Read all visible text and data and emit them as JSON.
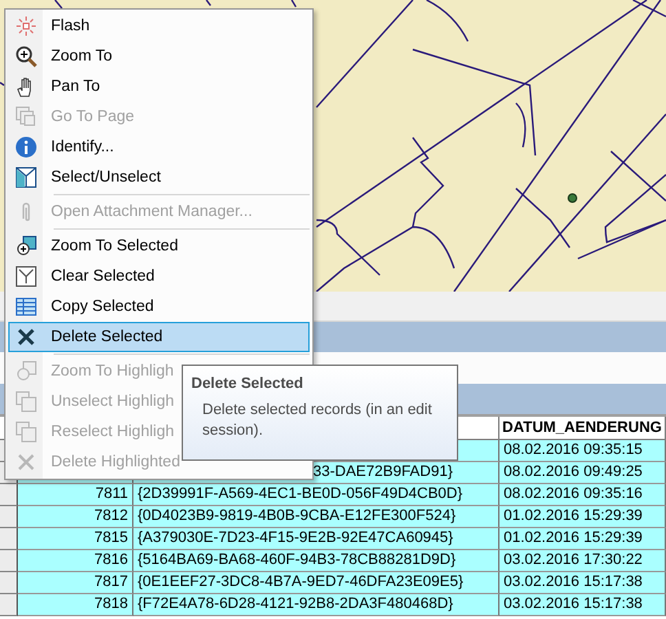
{
  "context_menu": {
    "items": [
      {
        "kind": "item",
        "label": "Flash",
        "disabled": false,
        "selected": false
      },
      {
        "kind": "item",
        "label": "Zoom To",
        "disabled": false,
        "selected": false
      },
      {
        "kind": "item",
        "label": "Pan To",
        "disabled": false,
        "selected": false
      },
      {
        "kind": "item",
        "label": "Go To Page",
        "disabled": true,
        "selected": false
      },
      {
        "kind": "item",
        "label": "Identify...",
        "disabled": false,
        "selected": false
      },
      {
        "kind": "item",
        "label": "Select/Unselect",
        "disabled": false,
        "selected": false
      },
      {
        "kind": "separator"
      },
      {
        "kind": "item",
        "label": "Open Attachment Manager...",
        "disabled": true,
        "selected": false
      },
      {
        "kind": "separator"
      },
      {
        "kind": "item",
        "label": "Zoom To Selected",
        "disabled": false,
        "selected": false
      },
      {
        "kind": "item",
        "label": "Clear Selected",
        "disabled": false,
        "selected": false
      },
      {
        "kind": "item",
        "label": "Copy Selected",
        "disabled": false,
        "selected": false
      },
      {
        "kind": "item",
        "label": "Delete Selected",
        "disabled": false,
        "selected": true
      },
      {
        "kind": "separator"
      },
      {
        "kind": "item",
        "label": "Zoom To Highligh",
        "disabled": true,
        "selected": false
      },
      {
        "kind": "item",
        "label": "Unselect Highligh",
        "disabled": true,
        "selected": false
      },
      {
        "kind": "item",
        "label": "Reselect Highligh",
        "disabled": true,
        "selected": false
      },
      {
        "kind": "item",
        "label": "Delete Highlighted",
        "disabled": true,
        "selected": false
      }
    ]
  },
  "tooltip": {
    "title": "Delete Selected",
    "text": "Delete selected records (in an edit session)."
  },
  "table": {
    "columns": [
      {
        "label": "DATUM_AENDERUNG"
      }
    ],
    "rows": [
      {
        "selected": true,
        "column_3": "08.02.2016 09:35:15"
      },
      {
        "selected": true,
        "column_2": "33-DAE72B9FAD91}",
        "column_3": "08.02.2016 09:49:25"
      },
      {
        "selected": true,
        "column_1": "7811",
        "column_2": "{2D39991F-A569-4EC1-BE0D-056F49D4CB0D}",
        "column_3": "08.02.2016 09:35:16"
      },
      {
        "selected": true,
        "column_1": "7812",
        "column_2": "{0D4023B9-9819-4B0B-9CBA-E12FE300F524}",
        "column_3": "01.02.2016 15:29:39"
      },
      {
        "selected": true,
        "column_1": "7815",
        "column_2": "{A379030E-7D23-4F15-9E2B-92E47CA60945}",
        "column_3": "01.02.2016 15:29:39"
      },
      {
        "selected": true,
        "column_1": "7816",
        "column_2": "{5164BA69-BA68-460F-94B3-78CB88281D9D}",
        "column_3": "03.02.2016 17:30:22"
      },
      {
        "selected": true,
        "column_1": "7817",
        "column_2": "{0E1EEF27-3DC8-4B7A-9ED7-46DFA23E09E5}",
        "column_3": "03.02.2016 15:17:38"
      },
      {
        "selected": true,
        "column_1": "7818",
        "column_2": "{F72E4A78-6D28-4121-92B8-2DA3F480468D}",
        "column_3": "03.02.2016 15:17:38"
      }
    ]
  }
}
